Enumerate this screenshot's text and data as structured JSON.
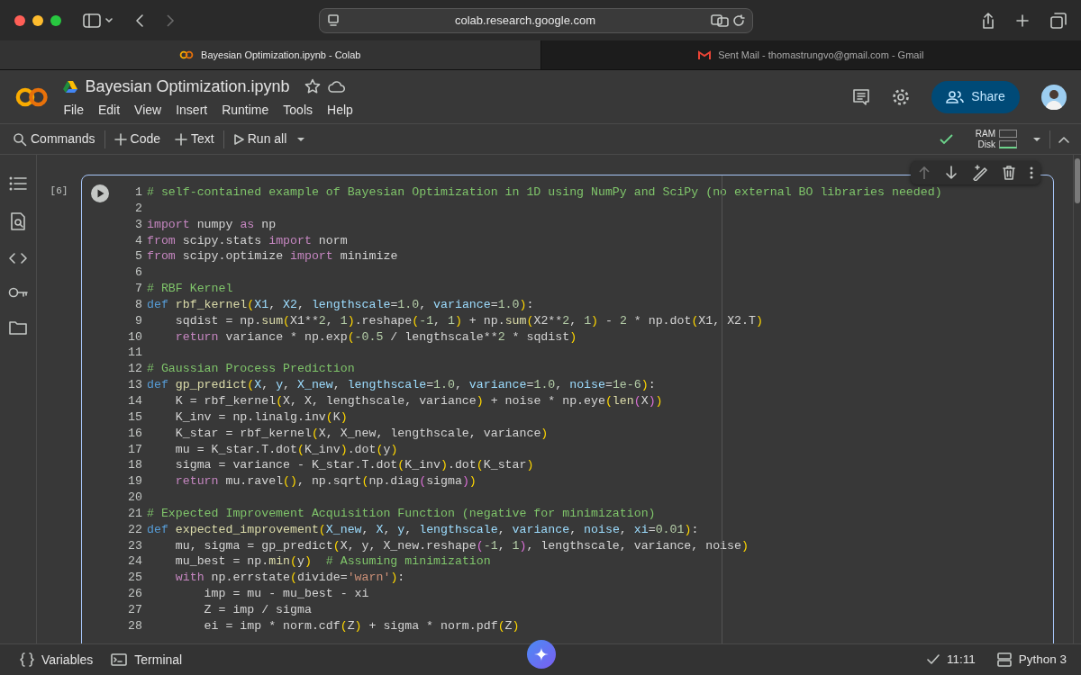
{
  "browser": {
    "url": "colab.research.google.com",
    "tabs": [
      {
        "title": "Bayesian Optimization.ipynb - Colab",
        "selected": true
      },
      {
        "title": "Sent Mail - thomastrungvo@gmail.com - Gmail",
        "selected": false
      }
    ]
  },
  "notebook": {
    "title": "Bayesian Optimization.ipynb",
    "menu": [
      "File",
      "Edit",
      "View",
      "Insert",
      "Runtime",
      "Tools",
      "Help"
    ],
    "share_label": "Share",
    "toolbar": {
      "commands": "Commands",
      "code": "Code",
      "text": "Text",
      "run_all": "Run all"
    },
    "resources": {
      "connected": true,
      "ram": "RAM",
      "disk": "Disk"
    },
    "cell": {
      "execution_count": "[6]",
      "lines": [
        {
          "no": "1",
          "tokens": [
            {
              "text": "# self-contained example of Bayesian Optimization in 1D using NumPy and SciPy (no external BO libraries needed)",
              "kind": "comment"
            }
          ]
        },
        {
          "no": "2"
        },
        {
          "no": "3",
          "tokens": [
            {
              "text": "import",
              "kind": "keyword"
            },
            {
              "text": " numpy ",
              "kind": "plain"
            },
            {
              "text": "as",
              "kind": "keyword"
            },
            {
              "text": " np",
              "kind": "plain"
            }
          ]
        },
        {
          "no": "4",
          "tokens": [
            {
              "text": "from",
              "kind": "keyword"
            },
            {
              "text": " scipy.stats ",
              "kind": "plain"
            },
            {
              "text": "import",
              "kind": "keyword"
            },
            {
              "text": " norm",
              "kind": "plain"
            }
          ]
        },
        {
          "no": "5",
          "tokens": [
            {
              "text": "from",
              "kind": "keyword"
            },
            {
              "text": " scipy.optimize ",
              "kind": "plain"
            },
            {
              "text": "import",
              "kind": "keyword"
            },
            {
              "text": " minimize",
              "kind": "plain"
            }
          ]
        },
        {
          "no": "6"
        },
        {
          "no": "7",
          "tokens": [
            {
              "text": "# RBF Kernel",
              "kind": "comment"
            }
          ]
        },
        {
          "no": "8",
          "tokens": [
            {
              "text": "def ",
              "kind": "def"
            },
            {
              "text": "rbf_kernel",
              "kind": "function"
            },
            {
              "text": "(",
              "kind": "bracket"
            },
            {
              "text": "X1",
              "kind": "param"
            },
            {
              "text": ", ",
              "kind": "plain"
            },
            {
              "text": "X2",
              "kind": "param"
            },
            {
              "text": ", ",
              "kind": "plain"
            },
            {
              "text": "lengthscale",
              "kind": "param"
            },
            {
              "text": "=",
              "kind": "plain"
            },
            {
              "text": "1.0",
              "kind": "number"
            },
            {
              "text": ", ",
              "kind": "plain"
            },
            {
              "text": "variance",
              "kind": "param"
            },
            {
              "text": "=",
              "kind": "plain"
            },
            {
              "text": "1.0",
              "kind": "number"
            },
            {
              "text": ")",
              "kind": "bracket"
            },
            {
              "text": ":",
              "kind": "plain"
            }
          ]
        },
        {
          "no": "9",
          "tokens": [
            {
              "text": "    sqdist = np.",
              "kind": "plain"
            },
            {
              "text": "sum",
              "kind": "function"
            },
            {
              "text": "(",
              "kind": "bracket"
            },
            {
              "text": "X1**",
              "kind": "plain"
            },
            {
              "text": "2",
              "kind": "number"
            },
            {
              "text": ", ",
              "kind": "plain"
            },
            {
              "text": "1",
              "kind": "number"
            },
            {
              "text": ")",
              "kind": "bracket"
            },
            {
              "text": ".reshape",
              "kind": "plain"
            },
            {
              "text": "(",
              "kind": "bracket"
            },
            {
              "text": "-1",
              "kind": "number"
            },
            {
              "text": ", ",
              "kind": "plain"
            },
            {
              "text": "1",
              "kind": "number"
            },
            {
              "text": ")",
              "kind": "bracket"
            },
            {
              "text": " + np.",
              "kind": "plain"
            },
            {
              "text": "sum",
              "kind": "function"
            },
            {
              "text": "(",
              "kind": "bracket"
            },
            {
              "text": "X2**",
              "kind": "plain"
            },
            {
              "text": "2",
              "kind": "number"
            },
            {
              "text": ", ",
              "kind": "plain"
            },
            {
              "text": "1",
              "kind": "number"
            },
            {
              "text": ")",
              "kind": "bracket"
            },
            {
              "text": " - ",
              "kind": "plain"
            },
            {
              "text": "2",
              "kind": "number"
            },
            {
              "text": " * np.dot",
              "kind": "plain"
            },
            {
              "text": "(",
              "kind": "bracket"
            },
            {
              "text": "X1, X2.T",
              "kind": "plain"
            },
            {
              "text": ")",
              "kind": "bracket"
            }
          ]
        },
        {
          "no": "10",
          "tokens": [
            {
              "text": "    return",
              "kind": "keyword"
            },
            {
              "text": " variance * np.exp",
              "kind": "plain"
            },
            {
              "text": "(",
              "kind": "bracket"
            },
            {
              "text": "-0.5",
              "kind": "number"
            },
            {
              "text": " / lengthscale**",
              "kind": "plain"
            },
            {
              "text": "2",
              "kind": "number"
            },
            {
              "text": " * sqdist",
              "kind": "plain"
            },
            {
              "text": ")",
              "kind": "bracket"
            }
          ]
        },
        {
          "no": "11"
        },
        {
          "no": "12",
          "tokens": [
            {
              "text": "# Gaussian Process Prediction",
              "kind": "comment"
            }
          ]
        },
        {
          "no": "13",
          "tokens": [
            {
              "text": "def ",
              "kind": "def"
            },
            {
              "text": "gp_predict",
              "kind": "function"
            },
            {
              "text": "(",
              "kind": "bracket"
            },
            {
              "text": "X",
              "kind": "param"
            },
            {
              "text": ", ",
              "kind": "plain"
            },
            {
              "text": "y",
              "kind": "param"
            },
            {
              "text": ", ",
              "kind": "plain"
            },
            {
              "text": "X_new",
              "kind": "param"
            },
            {
              "text": ", ",
              "kind": "plain"
            },
            {
              "text": "lengthscale",
              "kind": "param"
            },
            {
              "text": "=",
              "kind": "plain"
            },
            {
              "text": "1.0",
              "kind": "number"
            },
            {
              "text": ", ",
              "kind": "plain"
            },
            {
              "text": "variance",
              "kind": "param"
            },
            {
              "text": "=",
              "kind": "plain"
            },
            {
              "text": "1.0",
              "kind": "number"
            },
            {
              "text": ", ",
              "kind": "plain"
            },
            {
              "text": "noise",
              "kind": "param"
            },
            {
              "text": "=",
              "kind": "plain"
            },
            {
              "text": "1e-6",
              "kind": "number"
            },
            {
              "text": ")",
              "kind": "bracket"
            },
            {
              "text": ":",
              "kind": "plain"
            }
          ]
        },
        {
          "no": "14",
          "tokens": [
            {
              "text": "    K = rbf_kernel",
              "kind": "plain"
            },
            {
              "text": "(",
              "kind": "bracket"
            },
            {
              "text": "X, X, lengthscale, variance",
              "kind": "plain"
            },
            {
              "text": ")",
              "kind": "bracket"
            },
            {
              "text": " + noise * np.eye",
              "kind": "plain"
            },
            {
              "text": "(",
              "kind": "bracket"
            },
            {
              "text": "len",
              "kind": "function"
            },
            {
              "text": "(",
              "kind": "inner-bracket"
            },
            {
              "text": "X",
              "kind": "plain"
            },
            {
              "text": ")",
              "kind": "inner-bracket"
            },
            {
              "text": ")",
              "kind": "bracket"
            }
          ]
        },
        {
          "no": "15",
          "tokens": [
            {
              "text": "    K_inv = np.linalg.inv",
              "kind": "plain"
            },
            {
              "text": "(",
              "kind": "bracket"
            },
            {
              "text": "K",
              "kind": "plain"
            },
            {
              "text": ")",
              "kind": "bracket"
            }
          ]
        },
        {
          "no": "16",
          "tokens": [
            {
              "text": "    K_star = rbf_kernel",
              "kind": "plain"
            },
            {
              "text": "(",
              "kind": "bracket"
            },
            {
              "text": "X, X_new, lengthscale, variance",
              "kind": "plain"
            },
            {
              "text": ")",
              "kind": "bracket"
            }
          ]
        },
        {
          "no": "17",
          "tokens": [
            {
              "text": "    mu = K_star.T.dot",
              "kind": "plain"
            },
            {
              "text": "(",
              "kind": "bracket"
            },
            {
              "text": "K_inv",
              "kind": "plain"
            },
            {
              "text": ")",
              "kind": "bracket"
            },
            {
              "text": ".dot",
              "kind": "plain"
            },
            {
              "text": "(",
              "kind": "bracket"
            },
            {
              "text": "y",
              "kind": "plain"
            },
            {
              "text": ")",
              "kind": "bracket"
            }
          ]
        },
        {
          "no": "18",
          "tokens": [
            {
              "text": "    sigma = variance - K_star.T.dot",
              "kind": "plain"
            },
            {
              "text": "(",
              "kind": "bracket"
            },
            {
              "text": "K_inv",
              "kind": "plain"
            },
            {
              "text": ")",
              "kind": "bracket"
            },
            {
              "text": ".dot",
              "kind": "plain"
            },
            {
              "text": "(",
              "kind": "bracket"
            },
            {
              "text": "K_star",
              "kind": "plain"
            },
            {
              "text": ")",
              "kind": "bracket"
            }
          ]
        },
        {
          "no": "19",
          "tokens": [
            {
              "text": "    return",
              "kind": "keyword"
            },
            {
              "text": " mu.ravel",
              "kind": "plain"
            },
            {
              "text": "()",
              "kind": "bracket"
            },
            {
              "text": ", np.sqrt",
              "kind": "plain"
            },
            {
              "text": "(",
              "kind": "bracket"
            },
            {
              "text": "np.diag",
              "kind": "plain"
            },
            {
              "text": "(",
              "kind": "inner-bracket"
            },
            {
              "text": "sigma",
              "kind": "plain"
            },
            {
              "text": ")",
              "kind": "inner-bracket"
            },
            {
              "text": ")",
              "kind": "bracket"
            }
          ]
        },
        {
          "no": "20"
        },
        {
          "no": "21",
          "tokens": [
            {
              "text": "# Expected Improvement Acquisition Function (negative for minimization)",
              "kind": "comment"
            }
          ]
        },
        {
          "no": "22",
          "tokens": [
            {
              "text": "def ",
              "kind": "def"
            },
            {
              "text": "expected_improvement",
              "kind": "function"
            },
            {
              "text": "(",
              "kind": "bracket"
            },
            {
              "text": "X_new",
              "kind": "param"
            },
            {
              "text": ", ",
              "kind": "plain"
            },
            {
              "text": "X",
              "kind": "param"
            },
            {
              "text": ", ",
              "kind": "plain"
            },
            {
              "text": "y",
              "kind": "param"
            },
            {
              "text": ", ",
              "kind": "plain"
            },
            {
              "text": "lengthscale",
              "kind": "param"
            },
            {
              "text": ", ",
              "kind": "plain"
            },
            {
              "text": "variance",
              "kind": "param"
            },
            {
              "text": ", ",
              "kind": "plain"
            },
            {
              "text": "noise",
              "kind": "param"
            },
            {
              "text": ", ",
              "kind": "plain"
            },
            {
              "text": "xi",
              "kind": "param"
            },
            {
              "text": "=",
              "kind": "plain"
            },
            {
              "text": "0.01",
              "kind": "number"
            },
            {
              "text": ")",
              "kind": "bracket"
            },
            {
              "text": ":",
              "kind": "plain"
            }
          ]
        },
        {
          "no": "23",
          "tokens": [
            {
              "text": "    mu, sigma = gp_predict",
              "kind": "plain"
            },
            {
              "text": "(",
              "kind": "bracket"
            },
            {
              "text": "X, y, X_new.reshape",
              "kind": "plain"
            },
            {
              "text": "(",
              "kind": "inner-bracket"
            },
            {
              "text": "-1",
              "kind": "number"
            },
            {
              "text": ", ",
              "kind": "plain"
            },
            {
              "text": "1",
              "kind": "number"
            },
            {
              "text": ")",
              "kind": "inner-bracket"
            },
            {
              "text": ", lengthscale, variance, noise",
              "kind": "plain"
            },
            {
              "text": ")",
              "kind": "bracket"
            }
          ]
        },
        {
          "no": "24",
          "tokens": [
            {
              "text": "    mu_best = np.",
              "kind": "plain"
            },
            {
              "text": "min",
              "kind": "function"
            },
            {
              "text": "(",
              "kind": "bracket"
            },
            {
              "text": "y",
              "kind": "plain"
            },
            {
              "text": ")",
              "kind": "bracket"
            },
            {
              "text": "  # Assuming minimization",
              "kind": "comment"
            }
          ]
        },
        {
          "no": "25",
          "tokens": [
            {
              "text": "    with",
              "kind": "keyword"
            },
            {
              "text": " np.errstate",
              "kind": "plain"
            },
            {
              "text": "(",
              "kind": "bracket"
            },
            {
              "text": "divide=",
              "kind": "plain"
            },
            {
              "text": "'warn'",
              "kind": "string"
            },
            {
              "text": ")",
              "kind": "bracket"
            },
            {
              "text": ":",
              "kind": "plain"
            }
          ]
        },
        {
          "no": "26",
          "tokens": [
            {
              "text": "        imp = mu - mu_best - xi",
              "kind": "plain"
            }
          ]
        },
        {
          "no": "27",
          "tokens": [
            {
              "text": "        Z = imp / sigma",
              "kind": "plain"
            }
          ]
        },
        {
          "no": "28",
          "tokens": [
            {
              "text": "        ei = imp * norm.cdf",
              "kind": "plain"
            },
            {
              "text": "(",
              "kind": "bracket"
            },
            {
              "text": "Z",
              "kind": "plain"
            },
            {
              "text": ")",
              "kind": "bracket"
            },
            {
              "text": " + sigma * norm.pdf",
              "kind": "plain"
            },
            {
              "text": "(",
              "kind": "bracket"
            },
            {
              "text": "Z",
              "kind": "plain"
            },
            {
              "text": ")",
              "kind": "bracket"
            }
          ]
        }
      ]
    },
    "status": {
      "variables": "Variables",
      "terminal": "Terminal",
      "time": "11:11",
      "runtime": "Python 3"
    }
  }
}
